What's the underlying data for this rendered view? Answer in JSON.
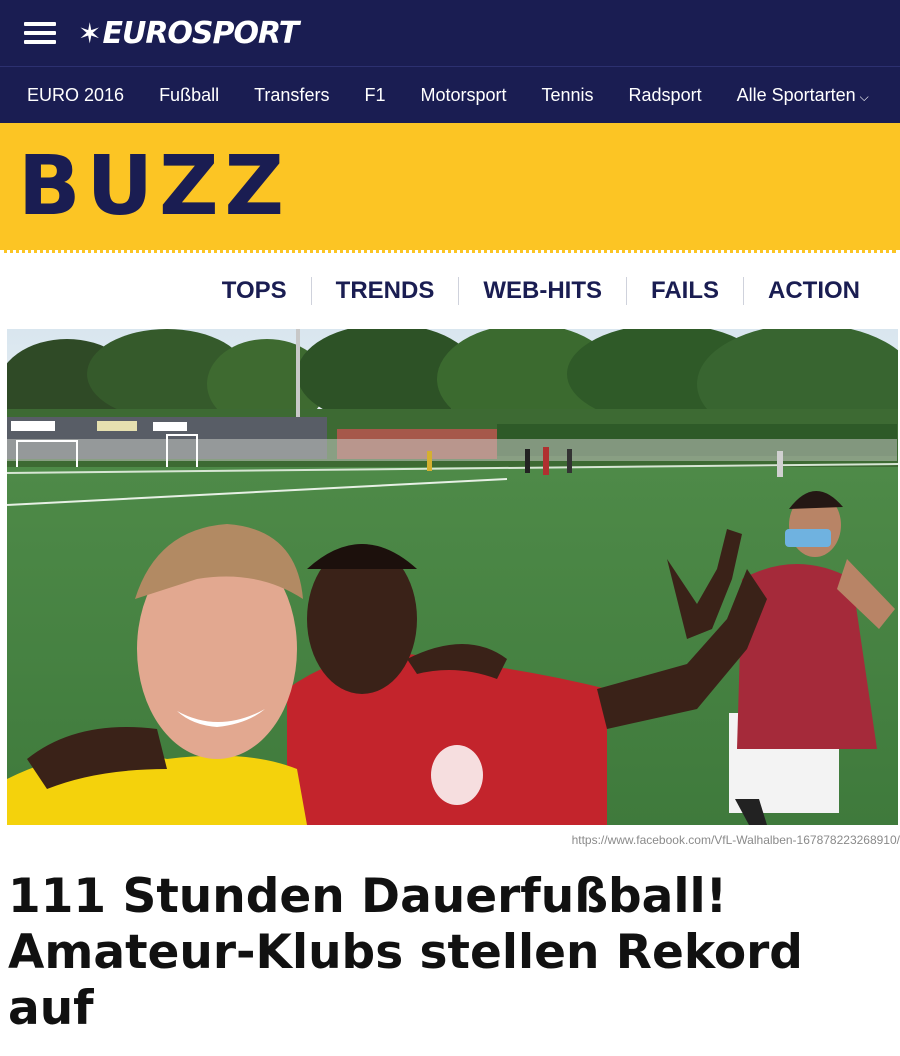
{
  "brand": {
    "name": "EUROSPORT"
  },
  "nav": {
    "items": [
      {
        "label": "EURO 2016"
      },
      {
        "label": "Fußball"
      },
      {
        "label": "Transfers"
      },
      {
        "label": "F1"
      },
      {
        "label": "Motorsport"
      },
      {
        "label": "Tennis"
      },
      {
        "label": "Radsport"
      },
      {
        "label": "Alle Sportarten"
      }
    ]
  },
  "section": {
    "title": "BUZZ"
  },
  "subnav": {
    "items": [
      {
        "label": "TOPS"
      },
      {
        "label": "TRENDS"
      },
      {
        "label": "WEB-HITS"
      },
      {
        "label": "FAILS"
      },
      {
        "label": "ACTION"
      }
    ]
  },
  "article": {
    "image_credit": "https://www.facebook.com/VfL-Walhalben-167878223268910/",
    "headline": "111 Stunden Dauerfußball! Amateur-Klubs stellen Rekord auf"
  },
  "colors": {
    "brand_navy": "#1a1d52",
    "buzz_yellow": "#fcc524"
  },
  "icons": [
    "menu-icon",
    "eurosport-star-icon",
    "chevron-down-icon"
  ]
}
